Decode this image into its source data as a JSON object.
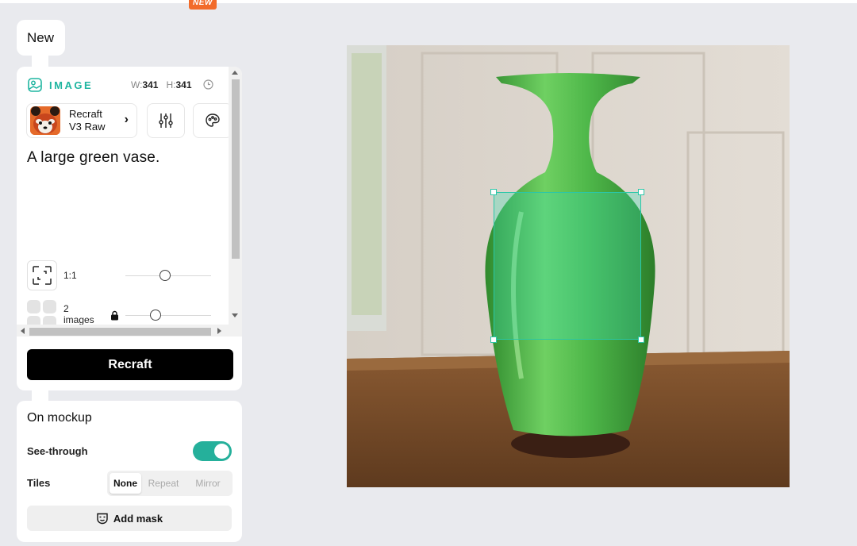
{
  "badge": {
    "new": "NEW"
  },
  "tab": {
    "label": "New"
  },
  "image_panel": {
    "section_label": "IMAGE",
    "width_label": "W:",
    "width_value": "341",
    "height_label": "H:",
    "height_value": "341",
    "model": {
      "line1": "Recraft",
      "line2": "V3 Raw"
    },
    "prompt": "A large green vase.",
    "aspect_ratio": "1:1",
    "images_count": "2",
    "images_label": "images",
    "generate_label": "Recraft"
  },
  "mockup_panel": {
    "title": "On mockup",
    "see_through_label": "See-through",
    "see_through_on": true,
    "tiles_label": "Tiles",
    "tiles_options": [
      "None",
      "Repeat",
      "Mirror"
    ],
    "tiles_selected": "None",
    "add_mask_label": "Add mask"
  },
  "colors": {
    "accent": "#25b09b",
    "badge": "#f26b2a",
    "vase": "#4fb84a"
  }
}
